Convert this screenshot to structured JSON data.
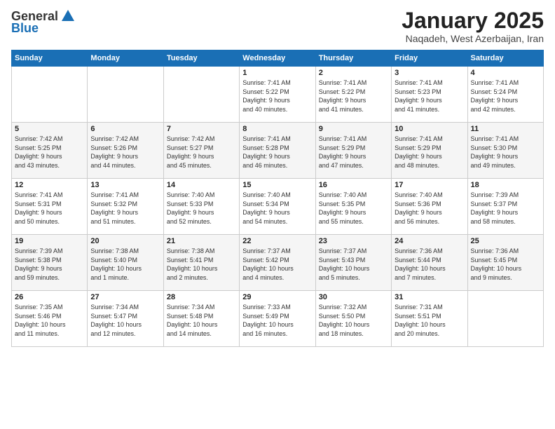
{
  "logo": {
    "general": "General",
    "blue": "Blue"
  },
  "header": {
    "month": "January 2025",
    "location": "Naqadeh, West Azerbaijan, Iran"
  },
  "days_of_week": [
    "Sunday",
    "Monday",
    "Tuesday",
    "Wednesday",
    "Thursday",
    "Friday",
    "Saturday"
  ],
  "weeks": [
    [
      {
        "day": "",
        "content": ""
      },
      {
        "day": "",
        "content": ""
      },
      {
        "day": "",
        "content": ""
      },
      {
        "day": "1",
        "content": "Sunrise: 7:41 AM\nSunset: 5:22 PM\nDaylight: 9 hours\nand 40 minutes."
      },
      {
        "day": "2",
        "content": "Sunrise: 7:41 AM\nSunset: 5:22 PM\nDaylight: 9 hours\nand 41 minutes."
      },
      {
        "day": "3",
        "content": "Sunrise: 7:41 AM\nSunset: 5:23 PM\nDaylight: 9 hours\nand 41 minutes."
      },
      {
        "day": "4",
        "content": "Sunrise: 7:41 AM\nSunset: 5:24 PM\nDaylight: 9 hours\nand 42 minutes."
      }
    ],
    [
      {
        "day": "5",
        "content": "Sunrise: 7:42 AM\nSunset: 5:25 PM\nDaylight: 9 hours\nand 43 minutes."
      },
      {
        "day": "6",
        "content": "Sunrise: 7:42 AM\nSunset: 5:26 PM\nDaylight: 9 hours\nand 44 minutes."
      },
      {
        "day": "7",
        "content": "Sunrise: 7:42 AM\nSunset: 5:27 PM\nDaylight: 9 hours\nand 45 minutes."
      },
      {
        "day": "8",
        "content": "Sunrise: 7:41 AM\nSunset: 5:28 PM\nDaylight: 9 hours\nand 46 minutes."
      },
      {
        "day": "9",
        "content": "Sunrise: 7:41 AM\nSunset: 5:29 PM\nDaylight: 9 hours\nand 47 minutes."
      },
      {
        "day": "10",
        "content": "Sunrise: 7:41 AM\nSunset: 5:29 PM\nDaylight: 9 hours\nand 48 minutes."
      },
      {
        "day": "11",
        "content": "Sunrise: 7:41 AM\nSunset: 5:30 PM\nDaylight: 9 hours\nand 49 minutes."
      }
    ],
    [
      {
        "day": "12",
        "content": "Sunrise: 7:41 AM\nSunset: 5:31 PM\nDaylight: 9 hours\nand 50 minutes."
      },
      {
        "day": "13",
        "content": "Sunrise: 7:41 AM\nSunset: 5:32 PM\nDaylight: 9 hours\nand 51 minutes."
      },
      {
        "day": "14",
        "content": "Sunrise: 7:40 AM\nSunset: 5:33 PM\nDaylight: 9 hours\nand 52 minutes."
      },
      {
        "day": "15",
        "content": "Sunrise: 7:40 AM\nSunset: 5:34 PM\nDaylight: 9 hours\nand 54 minutes."
      },
      {
        "day": "16",
        "content": "Sunrise: 7:40 AM\nSunset: 5:35 PM\nDaylight: 9 hours\nand 55 minutes."
      },
      {
        "day": "17",
        "content": "Sunrise: 7:40 AM\nSunset: 5:36 PM\nDaylight: 9 hours\nand 56 minutes."
      },
      {
        "day": "18",
        "content": "Sunrise: 7:39 AM\nSunset: 5:37 PM\nDaylight: 9 hours\nand 58 minutes."
      }
    ],
    [
      {
        "day": "19",
        "content": "Sunrise: 7:39 AM\nSunset: 5:38 PM\nDaylight: 9 hours\nand 59 minutes."
      },
      {
        "day": "20",
        "content": "Sunrise: 7:38 AM\nSunset: 5:40 PM\nDaylight: 10 hours\nand 1 minute."
      },
      {
        "day": "21",
        "content": "Sunrise: 7:38 AM\nSunset: 5:41 PM\nDaylight: 10 hours\nand 2 minutes."
      },
      {
        "day": "22",
        "content": "Sunrise: 7:37 AM\nSunset: 5:42 PM\nDaylight: 10 hours\nand 4 minutes."
      },
      {
        "day": "23",
        "content": "Sunrise: 7:37 AM\nSunset: 5:43 PM\nDaylight: 10 hours\nand 5 minutes."
      },
      {
        "day": "24",
        "content": "Sunrise: 7:36 AM\nSunset: 5:44 PM\nDaylight: 10 hours\nand 7 minutes."
      },
      {
        "day": "25",
        "content": "Sunrise: 7:36 AM\nSunset: 5:45 PM\nDaylight: 10 hours\nand 9 minutes."
      }
    ],
    [
      {
        "day": "26",
        "content": "Sunrise: 7:35 AM\nSunset: 5:46 PM\nDaylight: 10 hours\nand 11 minutes."
      },
      {
        "day": "27",
        "content": "Sunrise: 7:34 AM\nSunset: 5:47 PM\nDaylight: 10 hours\nand 12 minutes."
      },
      {
        "day": "28",
        "content": "Sunrise: 7:34 AM\nSunset: 5:48 PM\nDaylight: 10 hours\nand 14 minutes."
      },
      {
        "day": "29",
        "content": "Sunrise: 7:33 AM\nSunset: 5:49 PM\nDaylight: 10 hours\nand 16 minutes."
      },
      {
        "day": "30",
        "content": "Sunrise: 7:32 AM\nSunset: 5:50 PM\nDaylight: 10 hours\nand 18 minutes."
      },
      {
        "day": "31",
        "content": "Sunrise: 7:31 AM\nSunset: 5:51 PM\nDaylight: 10 hours\nand 20 minutes."
      },
      {
        "day": "",
        "content": ""
      }
    ]
  ]
}
